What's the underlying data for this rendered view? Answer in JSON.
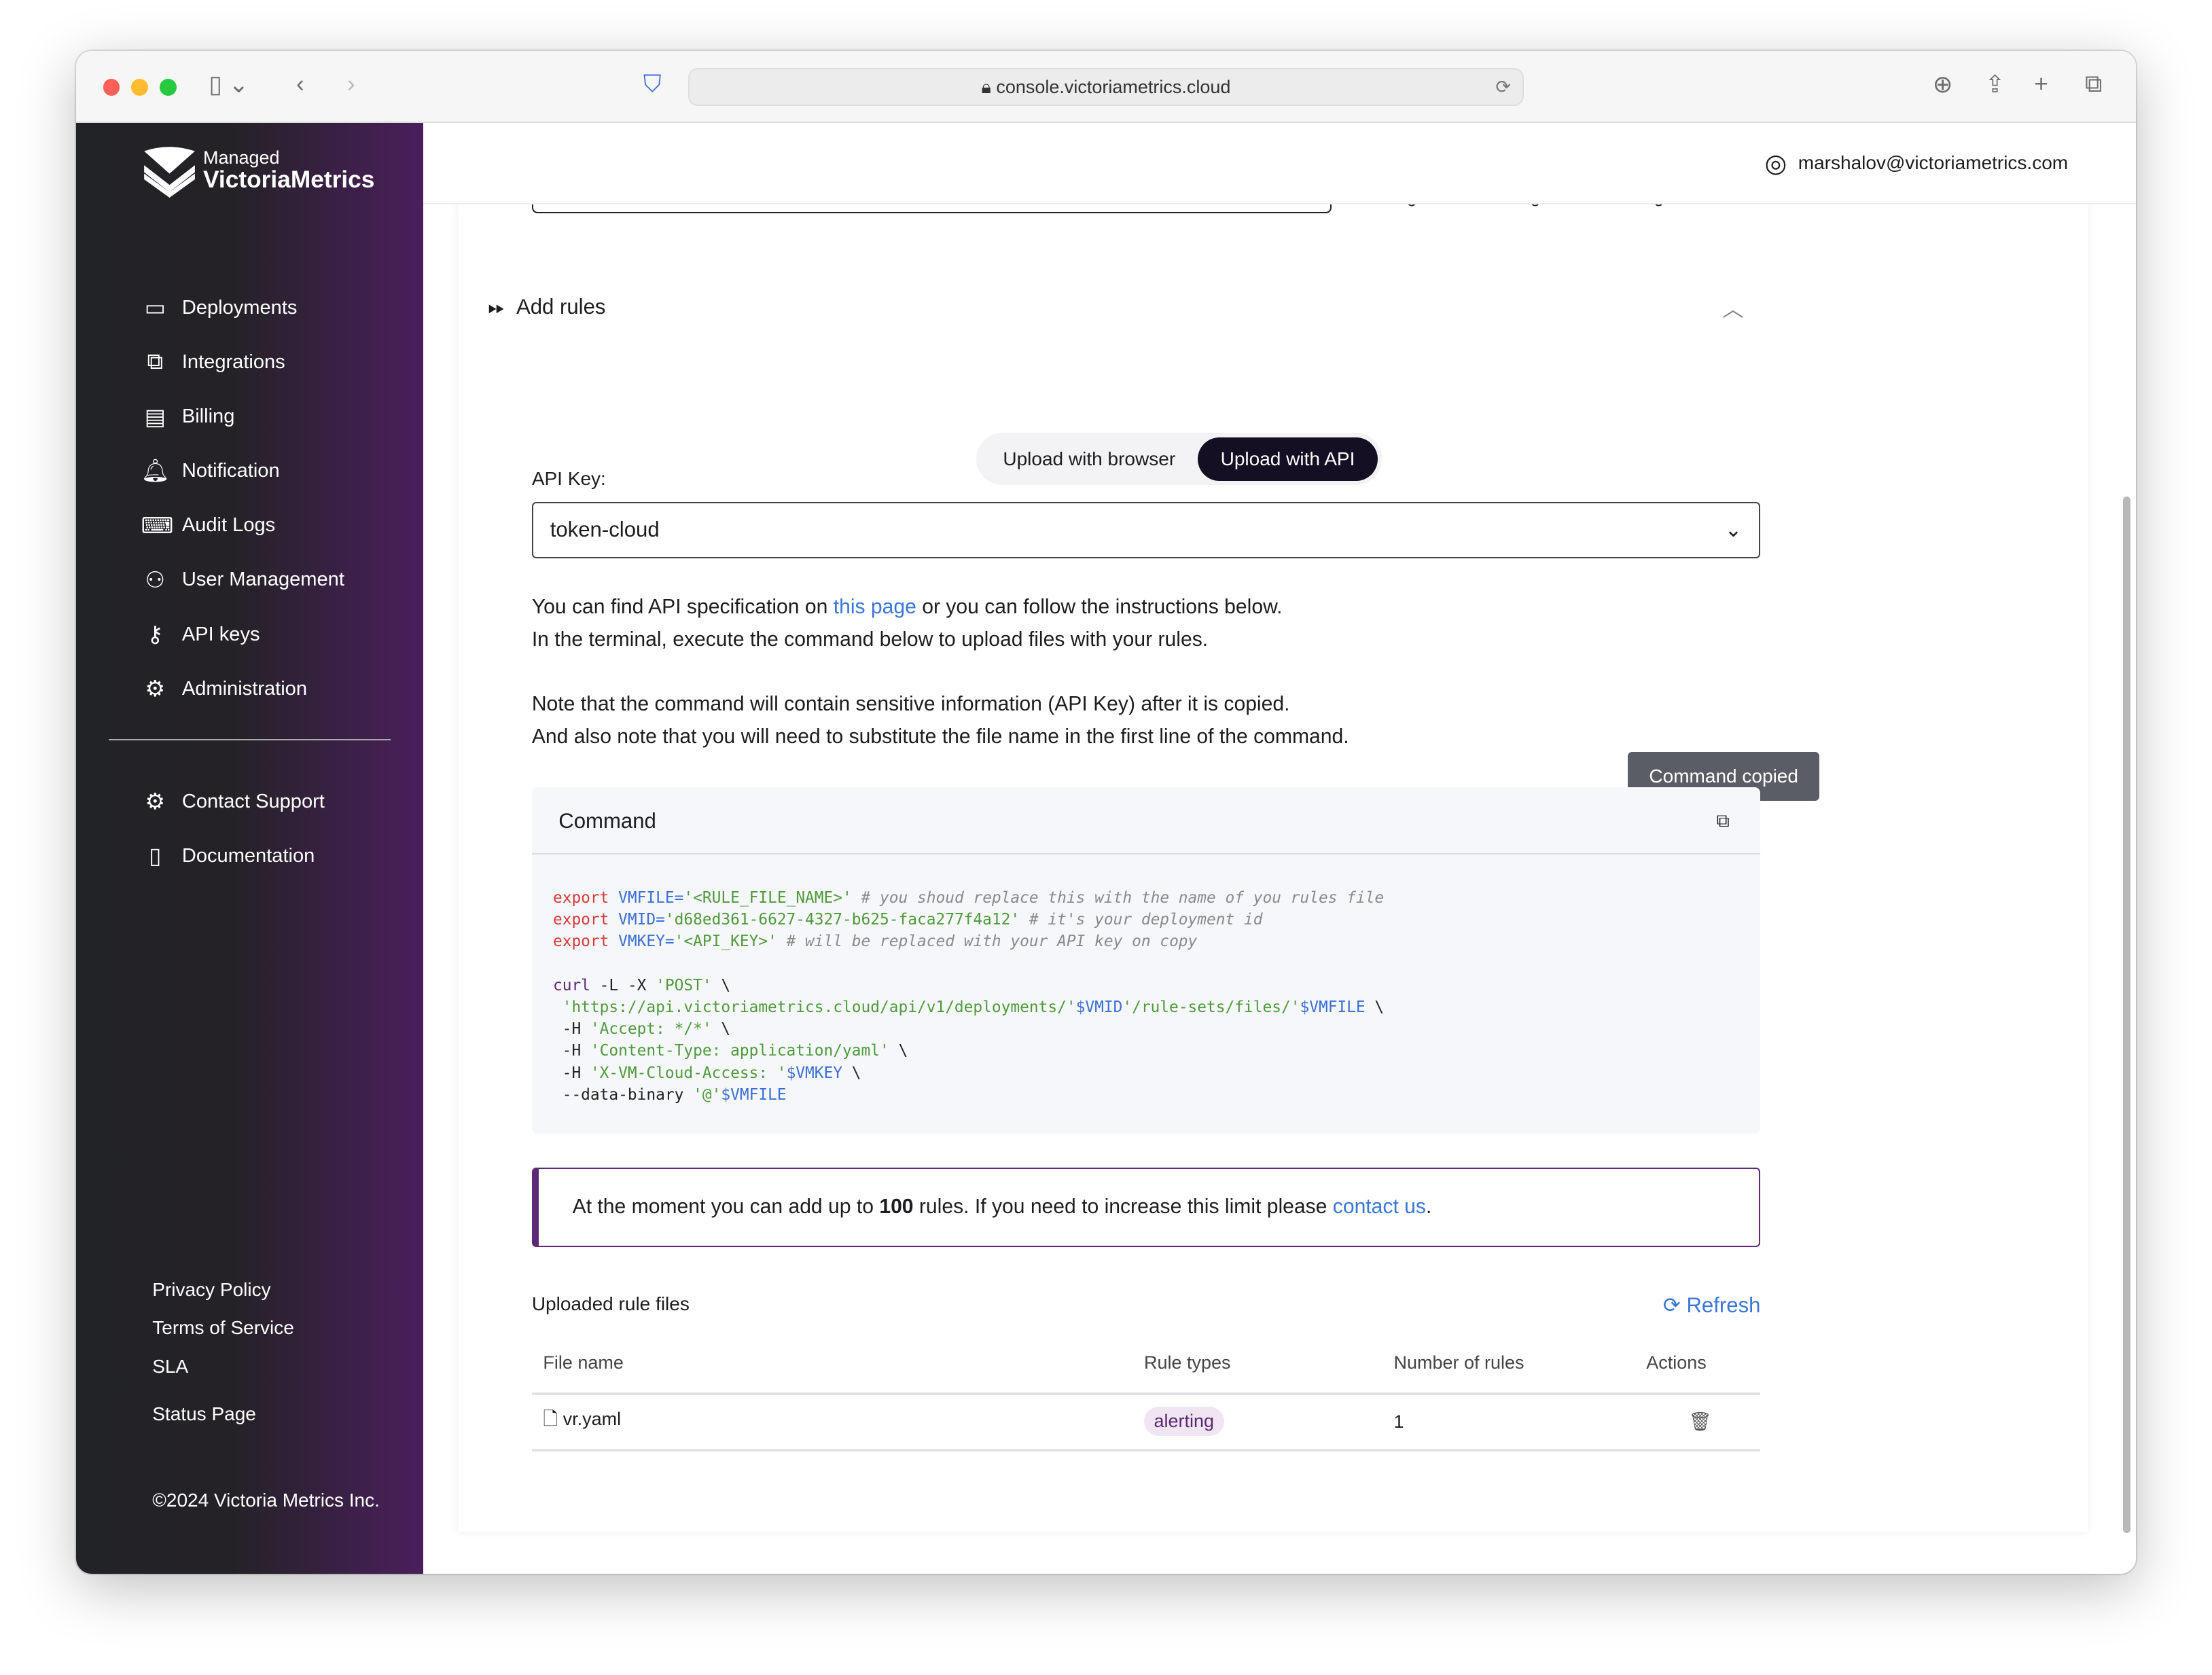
{
  "browser": {
    "url": "console.victoriametrics.cloud"
  },
  "logo": {
    "line1": "Managed",
    "line2": "VictoriaMetrics"
  },
  "sidebar": {
    "items": [
      {
        "label": "Deployments",
        "icon": "monitor-icon",
        "glyph": "▭"
      },
      {
        "label": "Integrations",
        "icon": "integrations-icon",
        "glyph": "⧉"
      },
      {
        "label": "Billing",
        "icon": "credit-card-icon",
        "glyph": "▤"
      },
      {
        "label": "Notification",
        "icon": "bell-icon",
        "glyph": "🔔︎"
      },
      {
        "label": "Audit Logs",
        "icon": "terminal-icon",
        "glyph": "⌨"
      },
      {
        "label": "User Management",
        "icon": "users-icon",
        "glyph": "⚇"
      },
      {
        "label": "API keys",
        "icon": "key-icon",
        "glyph": "⚷"
      },
      {
        "label": "Administration",
        "icon": "admin-icon",
        "glyph": "⚙"
      }
    ],
    "secondary": [
      {
        "label": "Contact Support",
        "icon": "support-icon",
        "glyph": "⚙"
      },
      {
        "label": "Documentation",
        "icon": "book-icon",
        "glyph": "▯"
      }
    ],
    "footer": [
      "Privacy Policy",
      "Terms of Service",
      "SLA",
      "Status Page"
    ],
    "copyright": "©2024 Victoria Metrics Inc."
  },
  "header": {
    "user_email": "marshalov@victoriametrics.com"
  },
  "partial": {
    "labels": [
      "configuration",
      "configuration",
      "configuration"
    ]
  },
  "section": {
    "title": "Add rules"
  },
  "tabs": [
    {
      "label": "Upload with browser",
      "active": false
    },
    {
      "label": "Upload with API",
      "active": true
    }
  ],
  "api_key": {
    "label": "API Key:",
    "value": "token-cloud"
  },
  "instructions": {
    "l1_pre": "You can find API specification on ",
    "l1_link": "this page",
    "l1_post": " or you can follow the instructions below.",
    "l2": "In the terminal, execute the command below to upload files with your rules.",
    "l3": "Note that the command will contain sensitive information (API Key) after it is copied.",
    "l4": "And also note that you will need to substitute the file name in the first line of the command."
  },
  "command": {
    "title": "Command",
    "tooltip": "Command copied",
    "lines": [
      [
        [
          "export ",
          "kw"
        ],
        [
          "VMFILE=",
          "var"
        ],
        [
          "'<RULE_FILE_NAME>'",
          "str"
        ],
        [
          " # you shoud replace this with the name of you rules file",
          "cm"
        ]
      ],
      [
        [
          "export ",
          "kw"
        ],
        [
          "VMID=",
          "var"
        ],
        [
          "'d68ed361-6627-4327-b625-faca277f4a12'",
          "str"
        ],
        [
          " # it's your deployment id",
          "cm"
        ]
      ],
      [
        [
          "export ",
          "kw"
        ],
        [
          "VMKEY=",
          "var"
        ],
        [
          "'<API_KEY>'",
          "str"
        ],
        [
          " # will be replaced with your API key on copy",
          "cm"
        ]
      ],
      [],
      [
        [
          "curl",
          "fn"
        ],
        [
          " -L -X ",
          "pl"
        ],
        [
          "'POST'",
          "str"
        ],
        [
          " \\",
          "pl"
        ]
      ],
      [
        [
          " 'https://api.victoriametrics.cloud/api/v1/deployments/'",
          "str"
        ],
        [
          "$VMID",
          "var"
        ],
        [
          "'/rule-sets/files/'",
          "str"
        ],
        [
          "$VMFILE",
          "var"
        ],
        [
          " \\",
          "pl"
        ]
      ],
      [
        [
          " -H ",
          "pl"
        ],
        [
          "'Accept: */*'",
          "str"
        ],
        [
          " \\",
          "pl"
        ]
      ],
      [
        [
          " -H ",
          "pl"
        ],
        [
          "'Content-Type: application/yaml'",
          "str"
        ],
        [
          " \\",
          "pl"
        ]
      ],
      [
        [
          " -H ",
          "pl"
        ],
        [
          "'X-VM-Cloud-Access: '",
          "str"
        ],
        [
          "$VMKEY",
          "var"
        ],
        [
          " \\",
          "pl"
        ]
      ],
      [
        [
          " --data-binary ",
          "pl"
        ],
        [
          "'@'",
          "str"
        ],
        [
          "$VMFILE",
          "var"
        ]
      ]
    ]
  },
  "colors": {
    "kw": "#d73a3a",
    "var": "#3b6fd6",
    "str": "#4f9a3b",
    "cm": "#8a8a8a",
    "fn": "#5b2870",
    "pl": "#222",
    "accent": "#5d2a75",
    "link": "#3b77d6"
  },
  "limit": {
    "pre": "At the moment you can add up to ",
    "count": "100",
    "mid": " rules. If you need to increase this limit please ",
    "link": "contact us",
    "post": "."
  },
  "files": {
    "title": "Uploaded rule files",
    "refresh": "Refresh",
    "columns": [
      "File name",
      "Rule types",
      "Number of rules",
      "Actions"
    ],
    "rows": [
      {
        "name": "vr.yaml",
        "type": "alerting",
        "count": "1"
      }
    ]
  }
}
